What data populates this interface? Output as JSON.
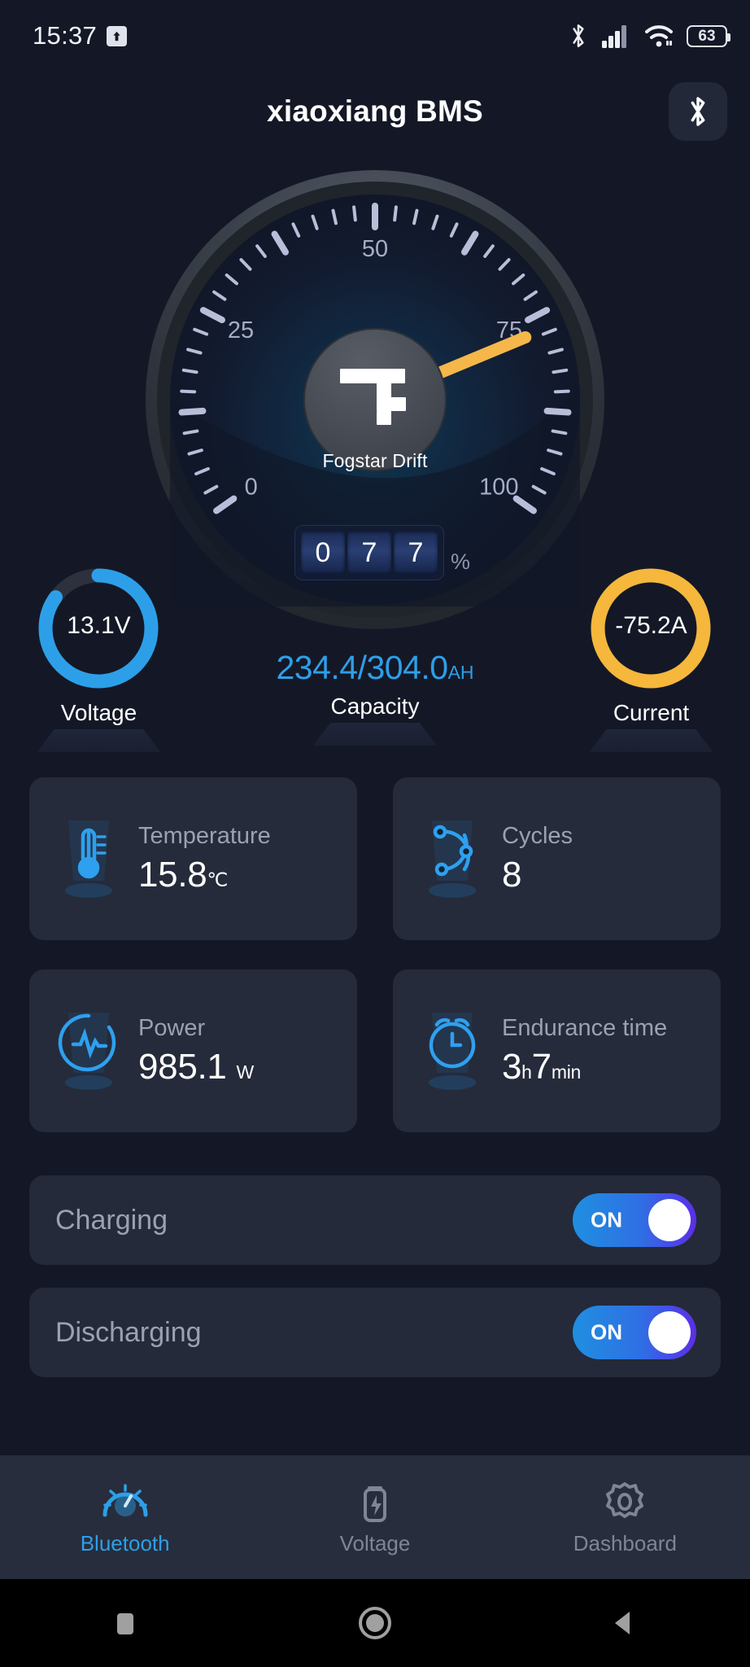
{
  "statusbar": {
    "clock": "15:37",
    "upload_icon": "upload-arrow-icon",
    "bluetooth_icon": "bluetooth-icon",
    "signal_icon": "cellular-signal-icon",
    "wifi_icon": "wifi-icon",
    "battery_icon": "battery-icon",
    "battery_level": "63"
  },
  "appbar": {
    "title": "xiaoxiang BMS",
    "bluetooth_button_icon": "bluetooth-icon"
  },
  "gauge": {
    "brand": "Fogstar Drift",
    "ticks": [
      "0",
      "25",
      "50",
      "75",
      "100"
    ],
    "min": 0,
    "max": 100,
    "value": 77,
    "unit": "%",
    "odometer_digits": [
      "0",
      "7",
      "7"
    ],
    "needle_color": "#f5b74a",
    "tick_color": "#b8bdd8"
  },
  "stats": {
    "voltage": {
      "label": "Voltage",
      "value": "13.1V",
      "ring_color": "#2d9fe8",
      "ring_pct": 85
    },
    "capacity": {
      "label": "Capacity",
      "value": "234.4/304.0",
      "unit": "AH",
      "color": "#2d9fe8"
    },
    "current": {
      "label": "Current",
      "value": "-75.2A",
      "ring_color": "#f5b73c",
      "ring_pct": 100
    }
  },
  "cards": [
    {
      "title": "Temperature",
      "value": "15.8",
      "unit": "℃",
      "icon": "thermometer-icon"
    },
    {
      "title": "Cycles",
      "value": "8",
      "unit": "",
      "icon": "cycles-icon"
    },
    {
      "title": "Power",
      "value": "985.1",
      "unit": "W",
      "icon": "power-pulse-icon"
    },
    {
      "title": "Endurance time",
      "value_h": "3",
      "unit_h": "h",
      "value_m": "7",
      "unit_m": "min",
      "icon": "alarm-clock-icon"
    }
  ],
  "toggles": [
    {
      "label": "Charging",
      "state": "ON"
    },
    {
      "label": "Discharging",
      "state": "ON"
    }
  ],
  "bottom_nav": [
    {
      "label": "Bluetooth",
      "icon": "speedometer-icon",
      "active": true
    },
    {
      "label": "Voltage",
      "icon": "battery-bolt-icon",
      "active": false
    },
    {
      "label": "Dashboard",
      "icon": "gear-icon",
      "active": false
    }
  ],
  "android_nav": [
    {
      "name": "recents",
      "icon": "square-icon"
    },
    {
      "name": "home",
      "icon": "circle-icon"
    },
    {
      "name": "back",
      "icon": "triangle-back-icon"
    }
  ]
}
